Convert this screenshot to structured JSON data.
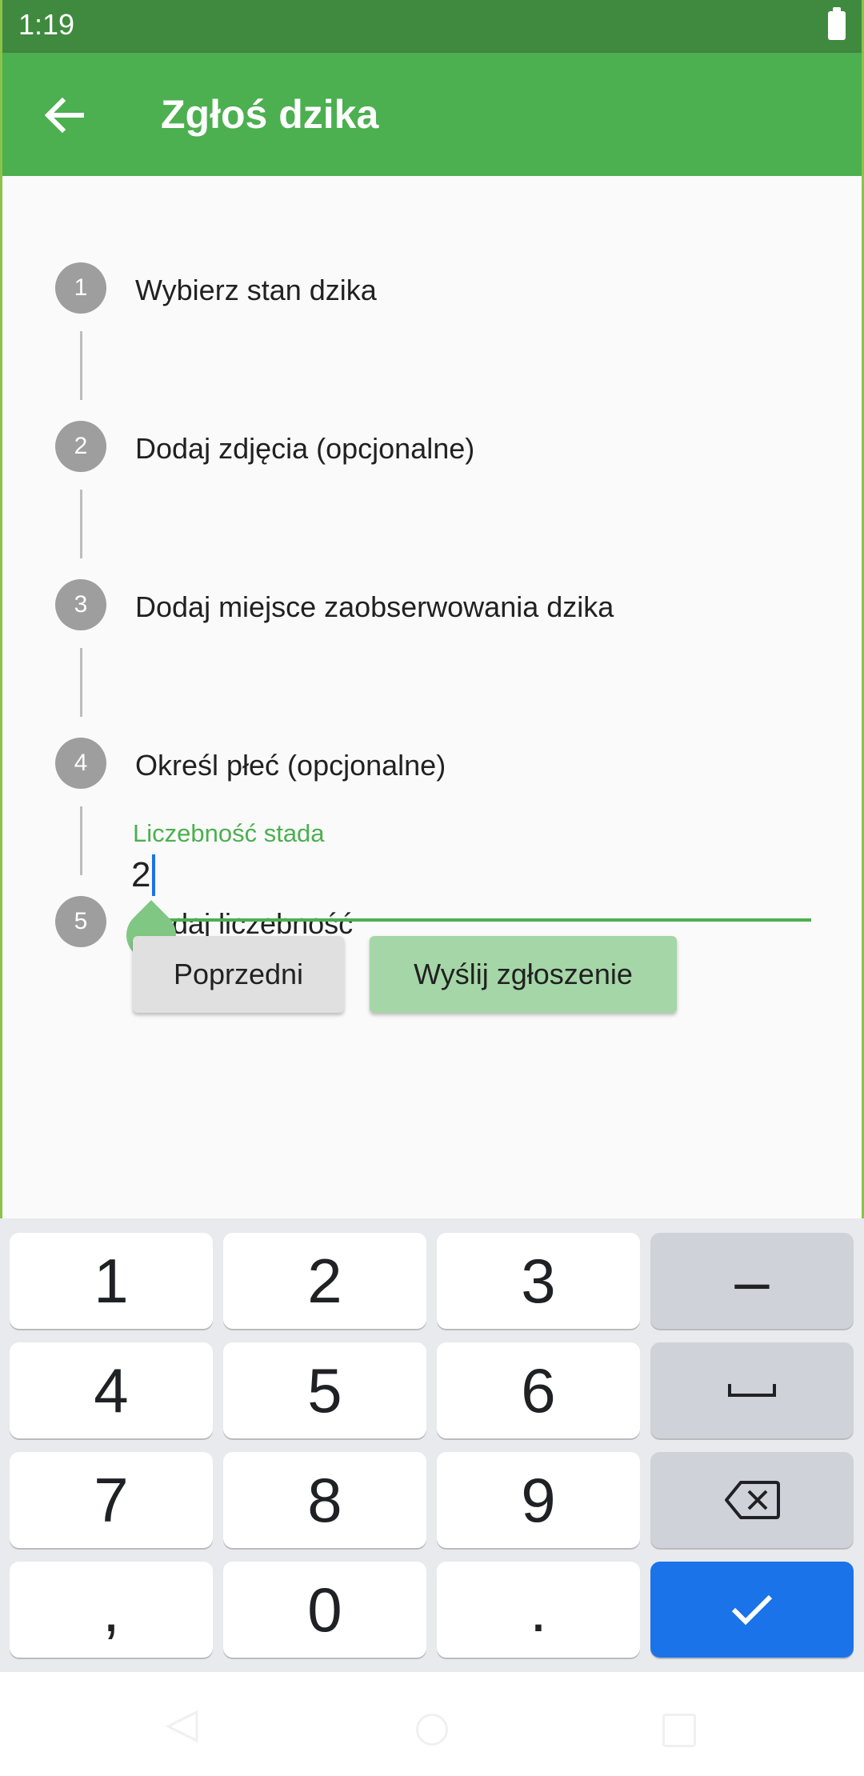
{
  "status_bar": {
    "time": "1:19"
  },
  "app_bar": {
    "title": "Zgłoś dzika"
  },
  "steps": [
    {
      "number": "1",
      "title": "Wybierz stan dzika"
    },
    {
      "number": "2",
      "title": "Dodaj zdjęcia (opcjonalne)"
    },
    {
      "number": "3",
      "title": "Dodaj miejsce zaobserwowania dzika"
    },
    {
      "number": "4",
      "title": "Określ płeć (opcjonalne)"
    },
    {
      "number": "5",
      "title": "Dodaj liczebność"
    }
  ],
  "herd_field": {
    "label": "Liczebność stada",
    "value": "2"
  },
  "buttons": {
    "previous": "Poprzedni",
    "submit": "Wyślij zgłoszenie"
  },
  "keyboard": {
    "digits": [
      "1",
      "2",
      "3",
      "4",
      "5",
      "6",
      "7",
      "8",
      "9",
      "0"
    ],
    "minus": "–",
    "comma": ",",
    "period": "."
  },
  "colors": {
    "app_bar": "#4caf50",
    "status_bar": "#3f8a3f",
    "accent_green": "#4caf50",
    "submit_button": "#a5d6a7",
    "keyboard_done": "#1a73e8"
  },
  "icons": {
    "back": "arrow-left-icon",
    "battery": "battery-icon",
    "space": "space-bar-icon",
    "backspace": "backspace-icon",
    "done": "check-icon"
  }
}
